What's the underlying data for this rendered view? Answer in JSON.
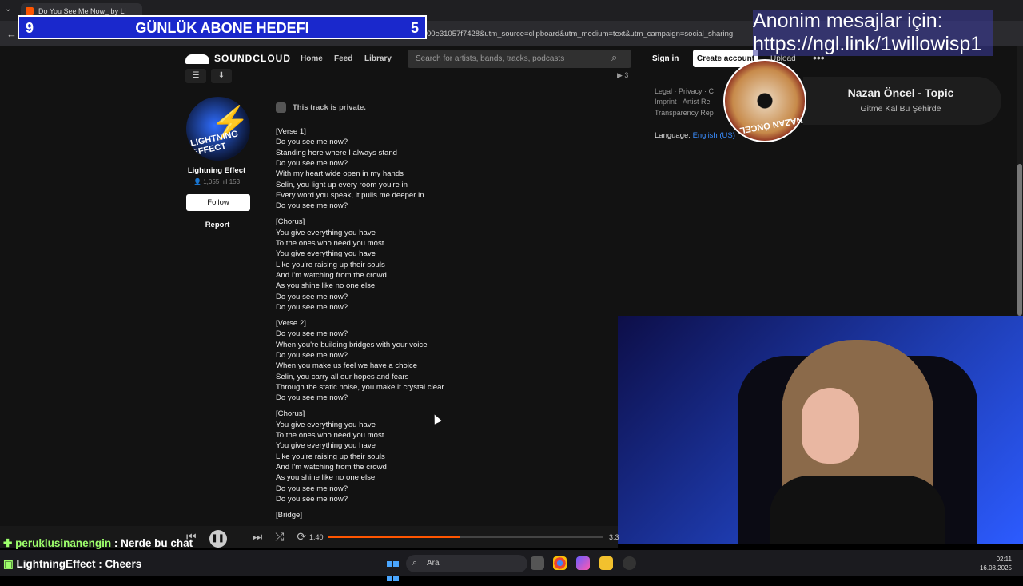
{
  "browser": {
    "tab_title": "Do You See Me Now_ by Li",
    "url": "00e31057f7428&utm_source=clipboard&utm_medium=text&utm_campaign=social_sharing"
  },
  "overlay": {
    "goal_left": "9",
    "goal_title": "GÜNLÜK ABONE HEDEFI",
    "goal_right": "5",
    "anon_line1": "Anonim mesajlar için:",
    "anon_line2": "https://ngl.link/1willowisp1"
  },
  "soundcloud": {
    "logo": "SOUNDCLOUD",
    "nav": [
      "Home",
      "Feed",
      "Library"
    ],
    "search_placeholder": "Search for artists, bands, tracks, podcasts",
    "sign_in": "Sign in",
    "create_account": "Create account",
    "upload": "Upload",
    "plays": "3",
    "user": {
      "name": "Lightning Effect",
      "avatar_text": "LIGHTNING EFFECT",
      "followers": "1,055",
      "tracks": "153",
      "follow": "Follow",
      "report": "Report"
    },
    "private_notice": "This track is private.",
    "lyrics": [
      "[Verse 1]",
      "Do you see me now?",
      "Standing here where I always stand",
      "Do you see me now?",
      "With my heart wide open in my hands",
      "Selin, you light up every room you're in",
      "Every word you speak, it pulls me deeper in",
      "Do you see me now?",
      "",
      "[Chorus]",
      "You give everything you have",
      "To the ones who need you most",
      "You give everything you have",
      "Like you're raising up their souls",
      "And I'm watching from the crowd",
      "As you shine like no one else",
      "Do you see me now?",
      "Do you see me now?",
      "",
      "[Verse 2]",
      "Do you see me now?",
      "When you're building bridges with your voice",
      "Do you see me now?",
      "When you make us feel we have a choice",
      "Selin, you carry all our hopes and fears",
      "Through the static noise, you make it crystal clear",
      "Do you see me now?",
      "",
      "[Chorus]",
      "You give everything you have",
      "To the ones who need you most",
      "You give everything you have",
      "Like you're raising up their souls",
      "And I'm watching from the crowd",
      "As you shine like no one else",
      "Do you see me now?",
      "Do you see me now?",
      "",
      "[Bridge]"
    ],
    "footer_links": [
      "Legal · Privacy · C",
      "Imprint · Artist Re",
      "Transparency Rep"
    ],
    "language_label": "Language:",
    "language_value": "English (US)"
  },
  "now_playing": {
    "artist": "Nazan Öncel - Topic",
    "song": "Gitme Kal Bu Şehirde",
    "disc_text": "NAZAN ÖNCEL"
  },
  "player": {
    "current_time": "1:40",
    "total_time": "3:3",
    "progress_fraction": 0.48
  },
  "chat": [
    {
      "user": "peruklusinanengin",
      "message": "Nerde bu chat"
    },
    {
      "user": "LightningEffect",
      "message": "Cheers"
    }
  ],
  "taskbar": {
    "search": "Ara",
    "time": "02:11",
    "date": "16.08.2025"
  }
}
